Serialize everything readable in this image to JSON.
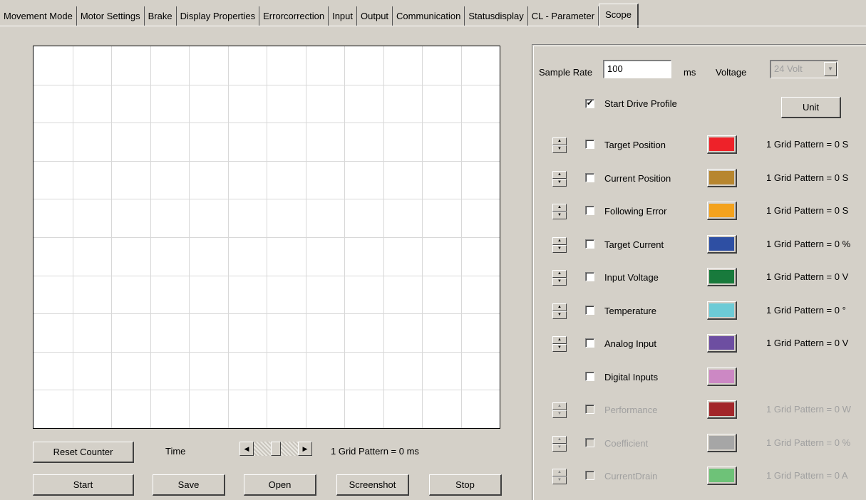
{
  "tabs": [
    {
      "label": "Movement Mode",
      "active": false
    },
    {
      "label": "Motor Settings",
      "active": false
    },
    {
      "label": "Brake",
      "active": false
    },
    {
      "label": "Display Properties",
      "active": false
    },
    {
      "label": "Errorcorrection",
      "active": false
    },
    {
      "label": "Input",
      "active": false
    },
    {
      "label": "Output",
      "active": false
    },
    {
      "label": "Communication",
      "active": false
    },
    {
      "label": "Statusdisplay",
      "active": false
    },
    {
      "label": "CL - Parameter",
      "active": false
    },
    {
      "label": "Scope",
      "active": true
    }
  ],
  "scope": {
    "grid_columns": 12,
    "grid_rows": 10
  },
  "controls": {
    "reset_counter": "Reset Counter",
    "time_label": "Time",
    "time_grid_label": "1 Grid Pattern = 0 ms",
    "start": "Start",
    "save": "Save",
    "open": "Open",
    "screenshot": "Screenshot",
    "stop": "Stop"
  },
  "settings": {
    "sample_rate_label": "Sample Rate",
    "sample_rate_value": "100",
    "sample_rate_unit": "ms",
    "voltage_label": "Voltage",
    "voltage_value": "24 Volt",
    "start_drive_profile_label": "Start Drive Profile",
    "start_drive_profile_checked": true,
    "unit_button": "Unit"
  },
  "channels": [
    {
      "label": "Target Position",
      "color": "#ee2229",
      "grid": "1 Grid Pattern = 0 S",
      "spinner": true,
      "enabled": true
    },
    {
      "label": "Current Position",
      "color": "#b7862f",
      "grid": "1 Grid Pattern = 0 S",
      "spinner": true,
      "enabled": true
    },
    {
      "label": "Following Error",
      "color": "#f4a21d",
      "grid": "1 Grid Pattern = 0 S",
      "spinner": true,
      "enabled": true
    },
    {
      "label": "Target Current",
      "color": "#2e4fa3",
      "grid": "1 Grid Pattern = 0 %",
      "spinner": true,
      "enabled": true
    },
    {
      "label": "Input Voltage",
      "color": "#187a3c",
      "grid": "1 Grid Pattern = 0 V",
      "spinner": true,
      "enabled": true
    },
    {
      "label": "Temperature",
      "color": "#6dcbd6",
      "grid": "1 Grid Pattern = 0 °",
      "spinner": true,
      "enabled": true
    },
    {
      "label": "Analog Input",
      "color": "#6d4ea1",
      "grid": "1 Grid Pattern = 0 V",
      "spinner": true,
      "enabled": true
    },
    {
      "label": "Digital Inputs",
      "color": "#cc88c4",
      "grid": "",
      "spinner": false,
      "enabled": true
    },
    {
      "label": "Performance",
      "color": "#a2262a",
      "grid": "1 Grid Pattern = 0 W",
      "spinner": true,
      "enabled": false
    },
    {
      "label": "Coefficient",
      "color": "#a6a6a6",
      "grid": "1 Grid Pattern = 0 %",
      "spinner": true,
      "enabled": false
    },
    {
      "label": "CurrentDrain",
      "color": "#6ec278",
      "grid": "1 Grid Pattern = 0 A",
      "spinner": true,
      "enabled": false
    }
  ]
}
